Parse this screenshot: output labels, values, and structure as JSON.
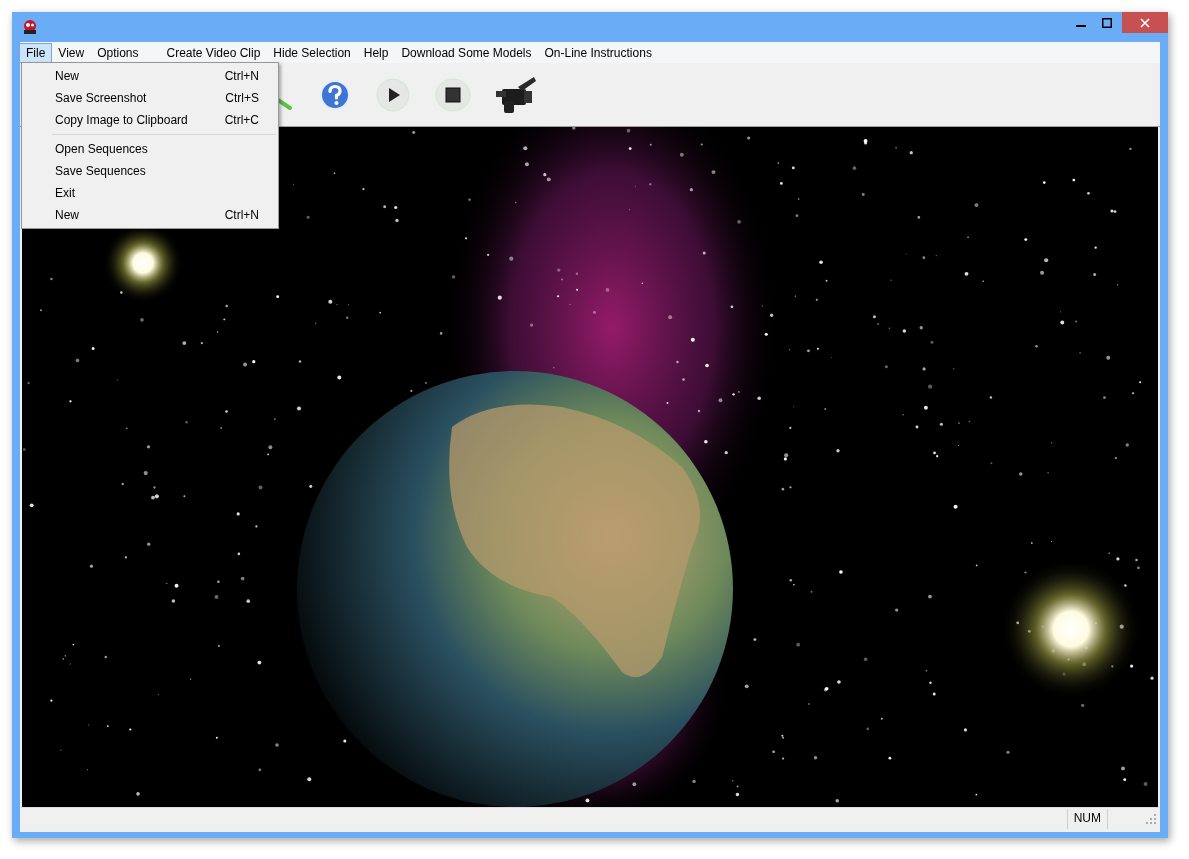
{
  "menu": [
    {
      "label": "File",
      "selected": true
    },
    {
      "label": "View",
      "selected": false
    },
    {
      "label": "Options",
      "selected": false
    },
    {
      "label": "Create Video Clip",
      "selected": false
    },
    {
      "label": "Hide Selection",
      "selected": false
    },
    {
      "label": "Help",
      "selected": false
    },
    {
      "label": "Download Some Models",
      "selected": false
    },
    {
      "label": "On-Line Instructions",
      "selected": false
    }
  ],
  "file_menu": {
    "groups": [
      [
        {
          "label": "New",
          "shortcut": "Ctrl+N"
        },
        {
          "label": "Save Screenshot",
          "shortcut": "Ctrl+S"
        },
        {
          "label": "Copy Image to Clipboard",
          "shortcut": "Ctrl+C"
        }
      ],
      [
        {
          "label": "Open Sequences"
        },
        {
          "label": "Save Sequences"
        },
        {
          "label": "Exit"
        },
        {
          "label": "New",
          "shortcut": "Ctrl+N"
        }
      ]
    ]
  },
  "toolbar": [
    {
      "kind": "brush"
    },
    {
      "kind": "help"
    },
    {
      "kind": "play"
    },
    {
      "kind": "stop"
    },
    {
      "kind": "camera"
    }
  ],
  "status_bar": {
    "indicator": "NUM"
  }
}
